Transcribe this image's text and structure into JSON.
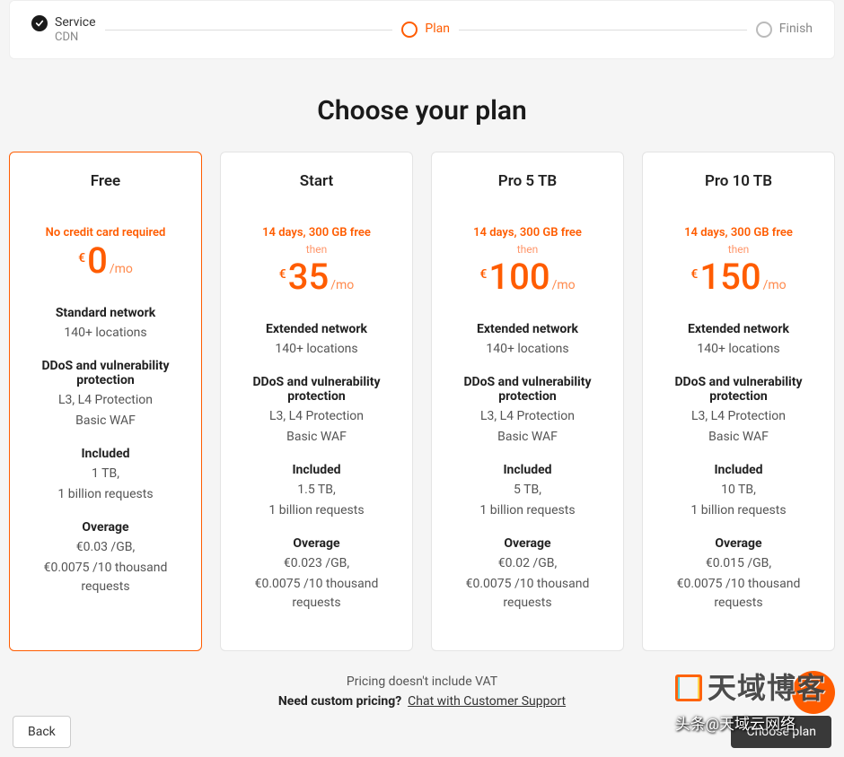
{
  "stepper": {
    "step1": {
      "label": "Service",
      "sub": "CDN"
    },
    "step2": {
      "label": "Plan"
    },
    "step3": {
      "label": "Finish"
    }
  },
  "title": "Choose your plan",
  "currency": "€",
  "period": "/mo",
  "then": "then",
  "plans": [
    {
      "name": "Free",
      "promo": "No credit card required",
      "promo_has_then": false,
      "price": "0",
      "network_title": "Standard network",
      "locations": "140+ locations",
      "ddos_title": "DDoS and vulnerability protection",
      "ddos_line1": "L3, L4 Protection",
      "ddos_line2": "Basic WAF",
      "included_title": "Included",
      "included_line1": "1 TB,",
      "included_line2": "1 billion requests",
      "overage_title": "Overage",
      "overage_line1": "€0.03 /GB,",
      "overage_line2": "€0.0075 /10 thousand requests",
      "selected": true
    },
    {
      "name": "Start",
      "promo": "14 days, 300 GB free",
      "promo_has_then": true,
      "price": "35",
      "network_title": "Extended network",
      "locations": "140+ locations",
      "ddos_title": "DDoS and vulnerability protection",
      "ddos_line1": "L3, L4 Protection",
      "ddos_line2": "Basic WAF",
      "included_title": "Included",
      "included_line1": "1.5 TB,",
      "included_line2": "1 billion requests",
      "overage_title": "Overage",
      "overage_line1": "€0.023 /GB,",
      "overage_line2": "€0.0075 /10 thousand requests",
      "selected": false
    },
    {
      "name": "Pro 5 TB",
      "promo": "14 days, 300 GB free",
      "promo_has_then": true,
      "price": "100",
      "network_title": "Extended network",
      "locations": "140+ locations",
      "ddos_title": "DDoS and vulnerability protection",
      "ddos_line1": "L3, L4 Protection",
      "ddos_line2": "Basic WAF",
      "included_title": "Included",
      "included_line1": "5 TB,",
      "included_line2": "1 billion requests",
      "overage_title": "Overage",
      "overage_line1": "€0.02 /GB,",
      "overage_line2": "€0.0075 /10 thousand requests",
      "selected": false
    },
    {
      "name": "Pro 10 TB",
      "promo": "14 days, 300 GB free",
      "promo_has_then": true,
      "price": "150",
      "network_title": "Extended network",
      "locations": "140+ locations",
      "ddos_title": "DDoS and vulnerability protection",
      "ddos_line1": "L3, L4 Protection",
      "ddos_line2": "Basic WAF",
      "included_title": "Included",
      "included_line1": "10 TB,",
      "included_line2": "1 billion requests",
      "overage_title": "Overage",
      "overage_line1": "€0.015 /GB,",
      "overage_line2": "€0.0075 /10 thousand requests",
      "selected": false
    }
  ],
  "footer": {
    "vat": "Pricing doesn't include VAT",
    "custom_prefix": "Need custom pricing?",
    "chat": "Chat with Customer Support"
  },
  "buttons": {
    "back": "Back",
    "choose": "Choose plan"
  },
  "watermark": {
    "brand": "天域博客",
    "byline": "头条@天域云网络"
  }
}
